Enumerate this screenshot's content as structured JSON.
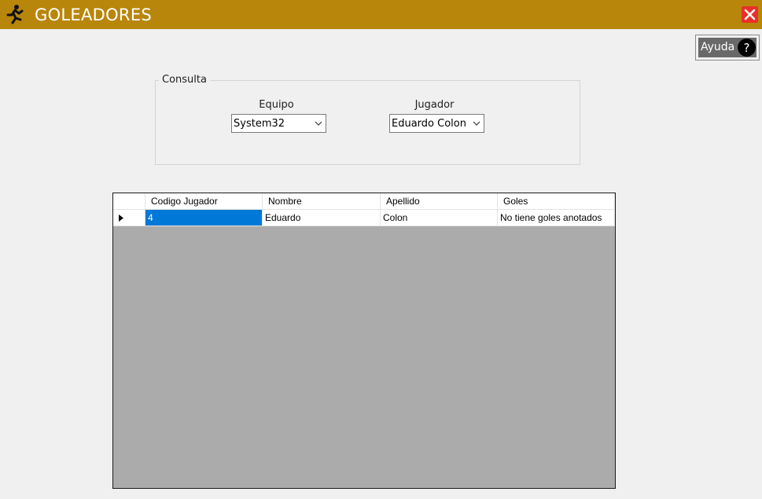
{
  "window": {
    "title": "GOLEADORES",
    "titlebar_color": "#b8860b",
    "app_icon": "running-player-icon",
    "close_icon": "close-icon"
  },
  "help": {
    "label": "Ayuda",
    "icon": "question-icon"
  },
  "query": {
    "group_title": "Consulta",
    "team_label": "Equipo",
    "team_value": "System32",
    "player_label": "Jugador",
    "player_value": "Eduardo Colon"
  },
  "grid": {
    "columns": [
      "Codigo Jugador",
      "Nombre",
      "Apellido",
      "Goles"
    ],
    "rows": [
      {
        "codigo": "4",
        "nombre": "Eduardo",
        "apellido": "Colon",
        "goles": "No tiene goles anotados"
      }
    ],
    "selection_color": "#0078d7"
  }
}
